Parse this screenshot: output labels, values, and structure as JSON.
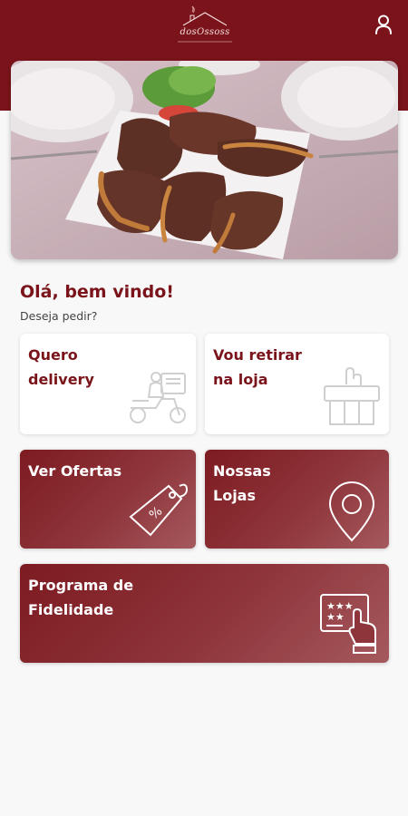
{
  "header": {
    "logo_text": "dosOssoss",
    "logo_alt": "restaurant-logo",
    "profile_icon": "user-icon"
  },
  "hero": {
    "image": "grilled-steak-plate-photo"
  },
  "greeting": {
    "title": "Olá, bem vindo!",
    "subtitle": "Deseja pedir?"
  },
  "cards": {
    "delivery": {
      "line1": "Quero",
      "line2": "delivery",
      "icon": "delivery-scooter-icon"
    },
    "pickup": {
      "line1": "Vou retirar",
      "line2": "na loja",
      "icon": "store-pickup-icon"
    },
    "offers": {
      "line1": "Ver Ofertas",
      "icon": "discount-tag-icon"
    },
    "stores": {
      "line1": "Nossas",
      "line2": "Lojas",
      "icon": "location-pin-icon"
    },
    "loyalty": {
      "line1": "Programa de",
      "line2": "Fidelidade",
      "icon": "loyalty-card-icon"
    }
  },
  "colors": {
    "brand": "#7a141a",
    "background": "#f8f8f8",
    "card_white": "#ffffff"
  }
}
